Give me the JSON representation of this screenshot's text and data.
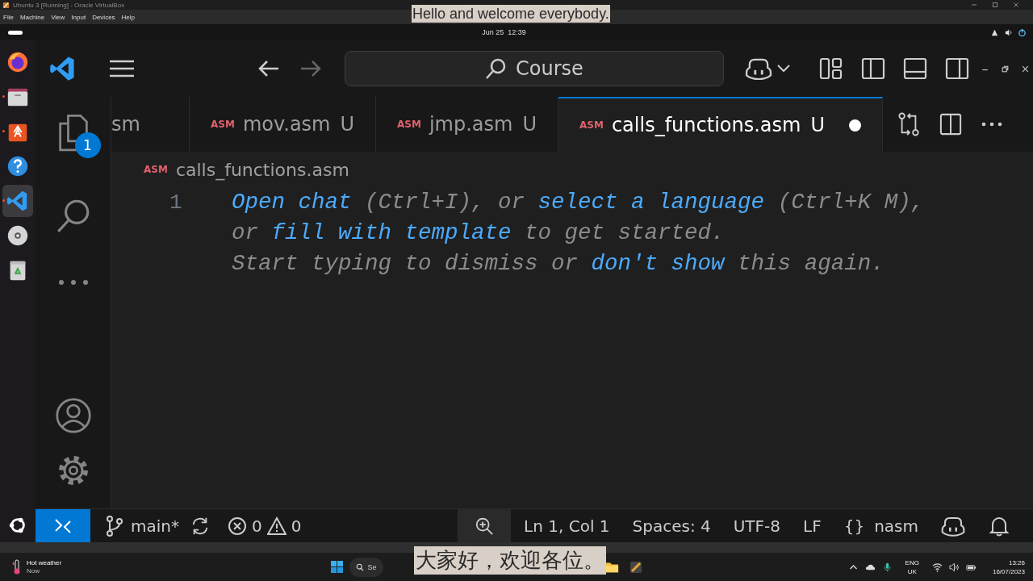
{
  "vbox": {
    "title": "Ubuntu 3 [Running] - Oracle VirtualBox",
    "menu": [
      "File",
      "Machine",
      "View",
      "Input",
      "Devices",
      "Help"
    ]
  },
  "captions": {
    "top": "Hello and welcome everybody.",
    "bottom": "大家好，欢迎各位。"
  },
  "ubuntu_bar": {
    "clock": "Jun 25  12:39"
  },
  "dock": [
    {
      "kind": "firefox",
      "running": false,
      "selected": false
    },
    {
      "kind": "files",
      "running": true,
      "selected": false
    },
    {
      "kind": "software",
      "running": true,
      "selected": false
    },
    {
      "kind": "help",
      "running": false,
      "selected": false
    },
    {
      "kind": "vscode",
      "running": true,
      "selected": true
    },
    {
      "kind": "disc",
      "running": false,
      "selected": false
    },
    {
      "kind": "trash",
      "running": false,
      "selected": false
    }
  ],
  "vscode": {
    "command_center": "Course",
    "explorer_badge": "1",
    "tabs": [
      {
        "label": "sm",
        "selected": false,
        "dirty": false
      },
      {
        "file_type": "ASM",
        "label": "mov.asm",
        "status": "U",
        "selected": false,
        "dirty": false
      },
      {
        "file_type": "ASM",
        "label": "jmp.asm",
        "status": "U",
        "selected": false,
        "dirty": false
      },
      {
        "file_type": "ASM",
        "label": "calls_functions.asm",
        "status": "U",
        "selected": true,
        "dirty": true
      }
    ],
    "breadcrumb": {
      "file_type": "ASM",
      "file": "calls_functions.asm"
    },
    "line_numbers": [
      "1"
    ],
    "hint": [
      [
        {
          "kind": "link",
          "text": "Open chat"
        },
        {
          "kind": "text",
          "text": " (Ctrl+I), or "
        },
        {
          "kind": "link",
          "text": "select a language"
        },
        {
          "kind": "text",
          "text": " (Ctrl+K M),"
        }
      ],
      [
        {
          "kind": "text",
          "text": "or "
        },
        {
          "kind": "link",
          "text": "fill with template"
        },
        {
          "kind": "text",
          "text": " to get started."
        }
      ],
      [
        {
          "kind": "text",
          "text": "Start typing to dismiss or "
        },
        {
          "kind": "link",
          "text": "don't show"
        },
        {
          "kind": "text",
          "text": " this again."
        }
      ]
    ],
    "status_bar": {
      "branch": "main*",
      "errors": "0",
      "warnings": "0",
      "position": "Ln 1, Col 1",
      "indentation": "Spaces: 4",
      "encoding": "UTF-8",
      "eol": "LF",
      "language_icon": "{}",
      "language": "nasm"
    }
  },
  "taskbar": {
    "weather": {
      "title": "Hot weather",
      "subtitle": "Now"
    },
    "search": "Se",
    "language": "ENG",
    "region": "UK",
    "time": "13:26",
    "date": "16/07/2023"
  }
}
